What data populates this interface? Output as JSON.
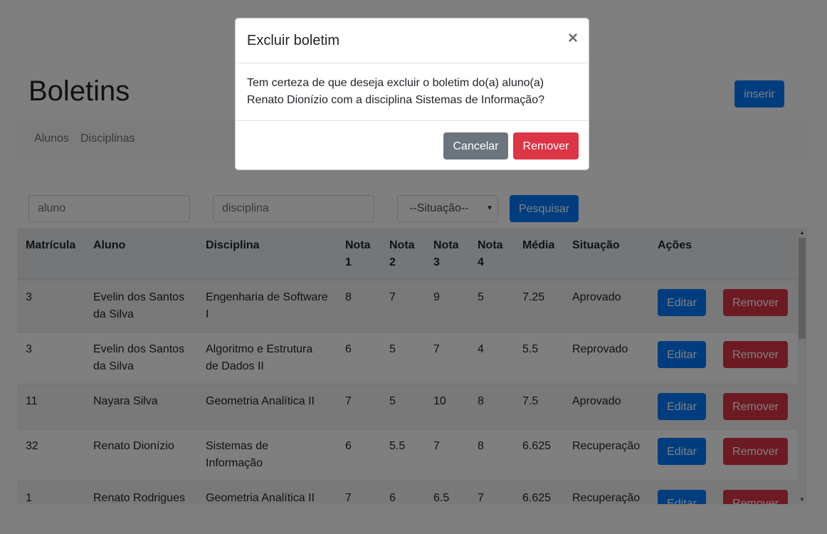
{
  "header": {
    "title": "Boletins",
    "insert_label": "inserir"
  },
  "nav": {
    "items": [
      {
        "label": "Alunos"
      },
      {
        "label": "Disciplinas"
      }
    ]
  },
  "filters": {
    "aluno_placeholder": "aluno",
    "disciplina_placeholder": "disciplina",
    "situacao_selected": "--Situação--",
    "search_label": "Pesquisar"
  },
  "table": {
    "headers": {
      "matricula": "Matrícula",
      "aluno": "Aluno",
      "disciplina": "Disciplina",
      "nota1a": "Nota",
      "nota1b": "1",
      "nota2a": "Nota",
      "nota2b": "2",
      "nota3a": "Nota",
      "nota3b": "3",
      "nota4a": "Nota",
      "nota4b": "4",
      "media": "Média",
      "situacao": "Situação",
      "acoes": "Ações"
    },
    "edit_label": "Editar",
    "remove_label": "Remover",
    "rows": [
      {
        "matricula": "3",
        "aluno_l1": "Evelin dos Santos",
        "aluno_l2": "da Silva",
        "disc_l1": "Engenharia de Software",
        "disc_l2": "I",
        "n1": "8",
        "n2": "7",
        "n3": "9",
        "n4": "5",
        "media": "7.25",
        "situacao": "Aprovado"
      },
      {
        "matricula": "3",
        "aluno_l1": "Evelin dos Santos",
        "aluno_l2": "da Silva",
        "disc_l1": "Algoritmo e Estrutura",
        "disc_l2": "de Dados II",
        "n1": "6",
        "n2": "5",
        "n3": "7",
        "n4": "4",
        "media": "5.5",
        "situacao": "Reprovado"
      },
      {
        "matricula": "11",
        "aluno_l1": "Nayara Silva",
        "aluno_l2": "",
        "disc_l1": "Geometria Analítica II",
        "disc_l2": "",
        "n1": "7",
        "n2": "5",
        "n3": "10",
        "n4": "8",
        "media": "7.5",
        "situacao": "Aprovado"
      },
      {
        "matricula": "32",
        "aluno_l1": "Renato Dionízio",
        "aluno_l2": "",
        "disc_l1": "Sistemas de",
        "disc_l2": "Informação",
        "n1": "6",
        "n2": "5.5",
        "n3": "7",
        "n4": "8",
        "media": "6.625",
        "situacao": "Recuperação"
      },
      {
        "matricula": "1",
        "aluno_l1": "Renato Rodrigues",
        "aluno_l2": "",
        "disc_l1": "Geometria Analítica II",
        "disc_l2": "",
        "n1": "7",
        "n2": "6",
        "n3": "6.5",
        "n4": "7",
        "media": "6.625",
        "situacao": "Recuperação"
      }
    ]
  },
  "modal": {
    "title": "Excluir boletim",
    "close_glyph": "×",
    "body_line1": "Tem certeza de que deseja excluir o boletim do(a) aluno(a)",
    "body_line2": "Renato Dionízio com a disciplina Sistemas de Informação?",
    "cancel_label": "Cancelar",
    "confirm_label": "Remover"
  },
  "colors": {
    "primary": "#007bff",
    "danger": "#dc3545",
    "secondary": "#6c757d"
  },
  "icons": {
    "select_caret": "caret-down-icon",
    "scroll_up": "scroll-up-arrow-icon",
    "scroll_down": "scroll-down-arrow-icon"
  }
}
